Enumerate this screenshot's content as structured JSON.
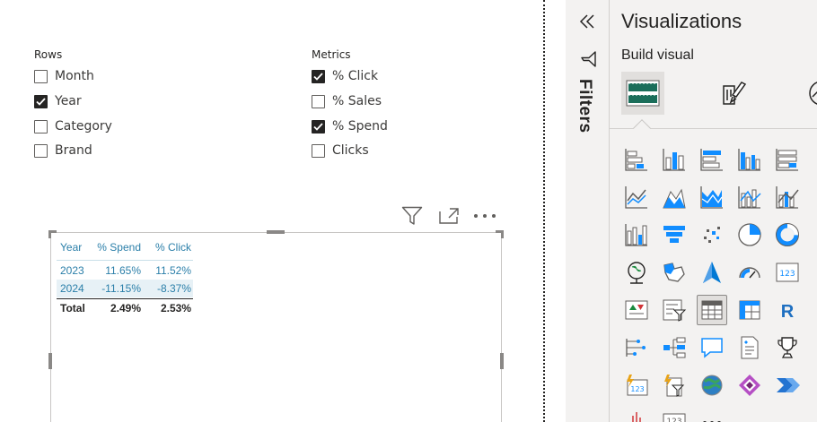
{
  "slicers": {
    "rows": {
      "title": "Rows",
      "items": [
        {
          "label": "Month",
          "checked": false
        },
        {
          "label": "Year",
          "checked": true
        },
        {
          "label": "Category",
          "checked": false
        },
        {
          "label": "Brand",
          "checked": false
        }
      ]
    },
    "metrics": {
      "title": "Metrics",
      "items": [
        {
          "label": "% Click",
          "checked": true
        },
        {
          "label": "% Sales",
          "checked": false
        },
        {
          "label": "% Spend",
          "checked": true
        },
        {
          "label": "Clicks",
          "checked": false
        }
      ]
    }
  },
  "table": {
    "columns": [
      "Year",
      "% Spend",
      "% Click"
    ],
    "rows": [
      [
        "2023",
        "11.65%",
        "11.52%"
      ],
      [
        "2024",
        "-11.15%",
        "-8.37%"
      ]
    ],
    "total": [
      "Total",
      "2.49%",
      "2.53%"
    ]
  },
  "filters_pane": {
    "label": "Filters"
  },
  "visualizations_pane": {
    "title": "Visualizations",
    "subtitle": "Build visual",
    "mode_tabs": [
      "table-tab-icon",
      "format-brush-icon",
      "analytics-icon"
    ],
    "active_visual": "table-icon"
  },
  "colors": {
    "accent": "#118dff",
    "table_header_text": "#2b7fa9",
    "pane_background": "#f3f2f1",
    "selected_tab_bg": "#e1dfdd"
  }
}
